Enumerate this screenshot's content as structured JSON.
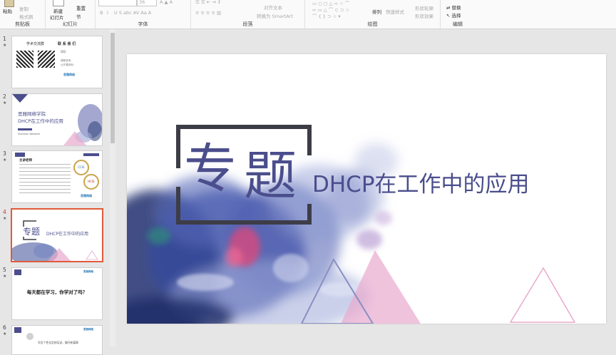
{
  "ribbon": {
    "clipboard": {
      "paste": "粘贴",
      "copy": "复制",
      "format_painter": "格式刷",
      "group": "剪贴板"
    },
    "slides": {
      "new_slide_line1": "新建",
      "new_slide_line2": "幻灯片",
      "reset": "重置",
      "section": "节",
      "group": "幻灯片"
    },
    "font": {
      "size": "36",
      "bold": "B",
      "italic": "I",
      "group": "字体"
    },
    "paragraph": {
      "align_text": "对齐文本",
      "convert_smartart": "转换为 SmartArt",
      "group": "段落"
    },
    "drawing": {
      "arrange": "排列",
      "quick_styles": "快速样式",
      "shape_fill": "形状轮廓",
      "shape_effects": "形状效果",
      "group": "绘图"
    },
    "editing": {
      "replace": "替换",
      "select": "选择",
      "group": "编辑"
    }
  },
  "thumbnails": {
    "slide1": {
      "num": "1",
      "star": "★",
      "title": "学术交流群",
      "contact": "联 系 我 们",
      "qq": "QQ",
      "phone": "课程咨询：",
      "phone2": "公开课咨询：",
      "logo": "思雅网络"
    },
    "slide2": {
      "num": "2",
      "star": "★",
      "line1": "思雅网络学院",
      "line2": "DHCP在工作中的应用",
      "author": "Shannon Network"
    },
    "slide3": {
      "num": "3",
      "star": "★",
      "heading": "主讲老师",
      "cert1": "CCIE",
      "cert2": "HCIE",
      "logo": "思雅网络"
    },
    "slide4": {
      "num": "4",
      "star": "★",
      "zhuan": "专题",
      "title": "DHCP在工作中的应用"
    },
    "slide5": {
      "num": "5",
      "star": "★",
      "text": "每天都在学习，你学对了吗？",
      "logo": "思雅网络"
    },
    "slide6": {
      "num": "6",
      "star": "★",
      "text": "学员个性化定制培训，翻开新篇章",
      "logo": "思雅网络"
    }
  },
  "main_slide": {
    "zhuan": "专",
    "ti": "题",
    "title": "DHCP在工作中的应用"
  },
  "colors": {
    "accent": "#4b4e8c",
    "frame": "#3d3d47",
    "active_border": "#e05a3a",
    "pink": "#e8aacd"
  }
}
